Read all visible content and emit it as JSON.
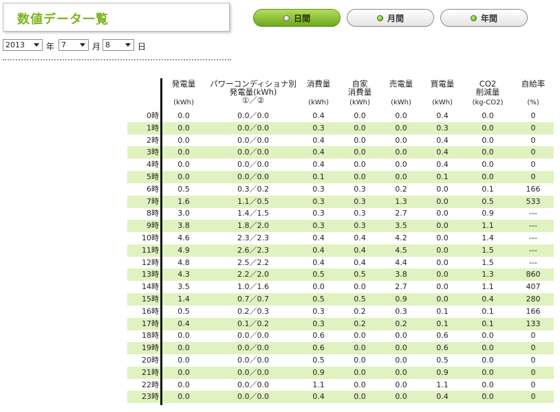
{
  "title": "数値データ一覧",
  "tabs": [
    "日間",
    "月間",
    "年間"
  ],
  "date": {
    "year": "2013",
    "month": "7",
    "day": "8",
    "year_unit": "年",
    "month_unit": "月",
    "day_unit": "日"
  },
  "table": {
    "headers": [
      {
        "lines": [
          "発電量"
        ],
        "unit": "(kWh)"
      },
      {
        "lines": [
          "パワーコンディショナ別",
          "発電量(kWh)",
          "①／②"
        ],
        "unit": ""
      },
      {
        "lines": [
          "消費量"
        ],
        "unit": "(kWh)"
      },
      {
        "lines": [
          "自家",
          "消費量"
        ],
        "unit": "(kWh)"
      },
      {
        "lines": [
          "売電量"
        ],
        "unit": "(kWh)"
      },
      {
        "lines": [
          "買電量"
        ],
        "unit": "(kWh)"
      },
      {
        "lines": [
          "CO2",
          "削減量"
        ],
        "unit": "(kg-CO2)"
      },
      {
        "lines": [
          "自給率"
        ],
        "unit": "(%)"
      }
    ],
    "rows": [
      [
        "0時",
        "0.0",
        "0.0／0.0",
        "0.4",
        "0.0",
        "0.0",
        "0.4",
        "0.0",
        "0"
      ],
      [
        "1時",
        "0.0",
        "0.0／0.0",
        "0.3",
        "0.0",
        "0.0",
        "0.3",
        "0.0",
        "0"
      ],
      [
        "2時",
        "0.0",
        "0.0／0.0",
        "0.4",
        "0.0",
        "0.0",
        "0.4",
        "0.0",
        "0"
      ],
      [
        "3時",
        "0.0",
        "0.0／0.0",
        "0.4",
        "0.0",
        "0.0",
        "0.4",
        "0.0",
        "0"
      ],
      [
        "4時",
        "0.0",
        "0.0／0.0",
        "0.4",
        "0.0",
        "0.0",
        "0.4",
        "0.0",
        "0"
      ],
      [
        "5時",
        "0.0",
        "0.0／0.0",
        "0.1",
        "0.0",
        "0.0",
        "0.1",
        "0.0",
        "0"
      ],
      [
        "6時",
        "0.5",
        "0.3／0.2",
        "0.3",
        "0.3",
        "0.2",
        "0.0",
        "0.1",
        "166"
      ],
      [
        "7時",
        "1.6",
        "1.1／0.5",
        "0.3",
        "0.3",
        "1.3",
        "0.0",
        "0.5",
        "533"
      ],
      [
        "8時",
        "3.0",
        "1.4／1.5",
        "0.3",
        "0.3",
        "2.7",
        "0.0",
        "0.9",
        "---"
      ],
      [
        "9時",
        "3.8",
        "1.8／2.0",
        "0.3",
        "0.3",
        "3.5",
        "0.0",
        "1.1",
        "---"
      ],
      [
        "10時",
        "4.6",
        "2.3／2.3",
        "0.4",
        "0.4",
        "4.2",
        "0.0",
        "1.4",
        "---"
      ],
      [
        "11時",
        "4.9",
        "2.6／2.3",
        "0.4",
        "0.4",
        "4.5",
        "0.0",
        "1.5",
        "---"
      ],
      [
        "12時",
        "4.8",
        "2.5／2.2",
        "0.4",
        "0.4",
        "4.4",
        "0.0",
        "1.5",
        "---"
      ],
      [
        "13時",
        "4.3",
        "2.2／2.0",
        "0.5",
        "0.5",
        "3.8",
        "0.0",
        "1.3",
        "860"
      ],
      [
        "14時",
        "3.5",
        "1.0／1.6",
        "0.0",
        "0.0",
        "2.7",
        "0.0",
        "1.1",
        "407"
      ],
      [
        "15時",
        "1.4",
        "0.7／0.7",
        "0.5",
        "0.5",
        "0.9",
        "0.0",
        "0.4",
        "280"
      ],
      [
        "16時",
        "0.5",
        "0.2／0.3",
        "0.3",
        "0.2",
        "0.3",
        "0.1",
        "0.1",
        "166"
      ],
      [
        "17時",
        "0.4",
        "0.1／0.2",
        "0.3",
        "0.2",
        "0.2",
        "0.1",
        "0.1",
        "133"
      ],
      [
        "18時",
        "0.0",
        "0.0／0.0",
        "0.6",
        "0.0",
        "0.0",
        "0.6",
        "0.0",
        "0"
      ],
      [
        "19時",
        "0.0",
        "0.0／0.0",
        "0.6",
        "0.0",
        "0.0",
        "0.6",
        "0.0",
        "0"
      ],
      [
        "20時",
        "0.0",
        "0.0／0.0",
        "0.5",
        "0.0",
        "0.0",
        "0.5",
        "0.0",
        "0"
      ],
      [
        "21時",
        "0.0",
        "0.0／0.0",
        "0.9",
        "0.0",
        "0.0",
        "0.9",
        "0.0",
        "0"
      ],
      [
        "22時",
        "0.0",
        "0.0／0.0",
        "1.1",
        "0.0",
        "0.0",
        "1.1",
        "0.0",
        "0"
      ],
      [
        "23時",
        "0.0",
        "0.0／0.0",
        "0.4",
        "0.0",
        "0.0",
        "0.4",
        "0.0",
        "0"
      ]
    ]
  },
  "colors": {
    "accent": "#7bb51b",
    "row_alt": "#e1f2c1",
    "tab_active": "#8cc63f"
  }
}
